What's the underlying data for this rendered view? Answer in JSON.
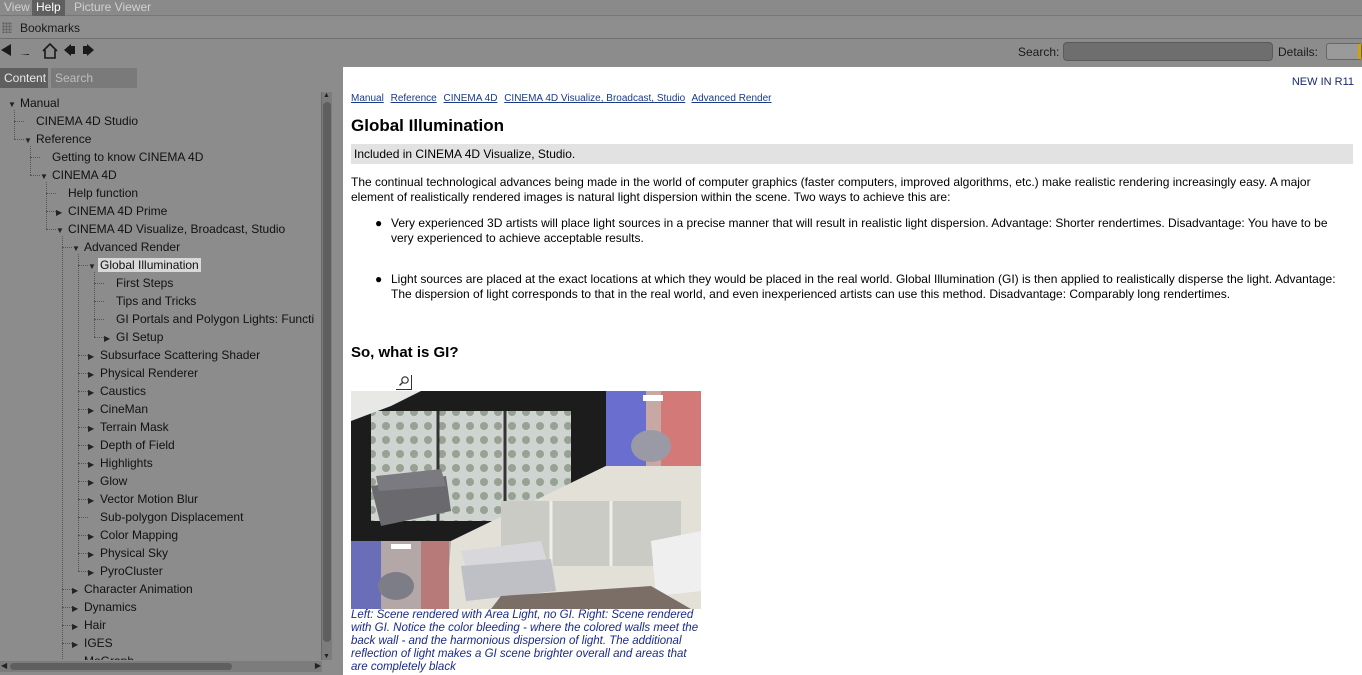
{
  "menu": {
    "items": [
      "View",
      "Help",
      "Picture Viewer"
    ],
    "active": "Help"
  },
  "bookmarks": {
    "label": "Bookmarks"
  },
  "toolbar": {
    "search_label": "Search:",
    "details_label": "Details:"
  },
  "tabs": {
    "content": "Content",
    "search_results": "Search Results"
  },
  "tree": {
    "items": [
      {
        "label": "Manual",
        "level": 0,
        "twisty": "open"
      },
      {
        "label": "CINEMA 4D Studio",
        "level": 1,
        "twisty": "none"
      },
      {
        "label": "Reference",
        "level": 1,
        "twisty": "open"
      },
      {
        "label": "Getting to know CINEMA 4D",
        "level": 2,
        "twisty": "none"
      },
      {
        "label": "CINEMA 4D",
        "level": 2,
        "twisty": "open"
      },
      {
        "label": "Help function",
        "level": 3,
        "twisty": "none"
      },
      {
        "label": "CINEMA 4D Prime",
        "level": 3,
        "twisty": "closed"
      },
      {
        "label": "CINEMA 4D Visualize, Broadcast, Studio",
        "level": 3,
        "twisty": "open"
      },
      {
        "label": "Advanced Render",
        "level": 4,
        "twisty": "open"
      },
      {
        "label": "Global Illumination",
        "level": 5,
        "twisty": "open",
        "selected": true
      },
      {
        "label": "First Steps",
        "level": 6,
        "twisty": "none"
      },
      {
        "label": "Tips and Tricks",
        "level": 6,
        "twisty": "none"
      },
      {
        "label": "GI Portals and Polygon Lights: Functi",
        "level": 6,
        "twisty": "none"
      },
      {
        "label": "GI Setup",
        "level": 6,
        "twisty": "closed"
      },
      {
        "label": "Subsurface Scattering Shader",
        "level": 5,
        "twisty": "closed"
      },
      {
        "label": "Physical Renderer",
        "level": 5,
        "twisty": "closed"
      },
      {
        "label": "Caustics",
        "level": 5,
        "twisty": "closed"
      },
      {
        "label": "CineMan",
        "level": 5,
        "twisty": "closed"
      },
      {
        "label": "Terrain Mask",
        "level": 5,
        "twisty": "closed"
      },
      {
        "label": "Depth of Field",
        "level": 5,
        "twisty": "closed"
      },
      {
        "label": "Highlights",
        "level": 5,
        "twisty": "closed"
      },
      {
        "label": "Glow",
        "level": 5,
        "twisty": "closed"
      },
      {
        "label": "Vector Motion Blur",
        "level": 5,
        "twisty": "closed"
      },
      {
        "label": "Sub-polygon Displacement",
        "level": 5,
        "twisty": "none"
      },
      {
        "label": "Color Mapping",
        "level": 5,
        "twisty": "closed"
      },
      {
        "label": "Physical Sky",
        "level": 5,
        "twisty": "closed"
      },
      {
        "label": "PyroCluster",
        "level": 5,
        "twisty": "closed"
      },
      {
        "label": "Character Animation",
        "level": 4,
        "twisty": "closed"
      },
      {
        "label": "Dynamics",
        "level": 4,
        "twisty": "closed"
      },
      {
        "label": "Hair",
        "level": 4,
        "twisty": "closed"
      },
      {
        "label": "IGES",
        "level": 4,
        "twisty": "closed"
      },
      {
        "label": "MoGraph",
        "level": 4,
        "twisty": "closed"
      }
    ]
  },
  "content": {
    "new_in": "NEW IN R11",
    "breadcrumb": [
      "Manual",
      "Reference",
      "CINEMA 4D",
      "CINEMA 4D Visualize, Broadcast, Studio",
      "Advanced Render"
    ],
    "title": "Global Illumination",
    "included": "Included in CINEMA 4D Visualize, Studio.",
    "intro": "The continual technological advances being made in the world of computer graphics (faster computers, improved algorithms, etc.) make realistic rendering increasingly easy. A major element of realistically rendered images is natural light dispersion within the scene. Two ways to achieve this are:",
    "bullets": [
      "Very experienced 3D artists will place light sources in a precise manner that will result in realistic light dispersion. Advantage: Shorter rendertimes. Disadvantage: You have to be very experienced to achieve acceptable results.",
      "Light sources are placed at the exact locations at which they would be placed in the real world. Global Illumination (GI) is then applied to realistically disperse the light. Advantage: The dispersion of light corresponds to that in the real world, and even inexperienced artists can use this method. Disadvantage: Comparably long rendertimes."
    ],
    "subtitle": "So, what is GI?",
    "caption": "Left: Scene rendered with Area Light, no GI. Right: Scene rendered with GI. Notice the color bleeding - where the colored walls meet the back wall - and the harmonious dispersion of light. The additional reflection of light makes a GI scene brighter overall and areas that are completely black"
  },
  "colors": {
    "link": "#1a3a8a",
    "caption": "#1a2a8a",
    "details_accent": "#d6a200"
  }
}
